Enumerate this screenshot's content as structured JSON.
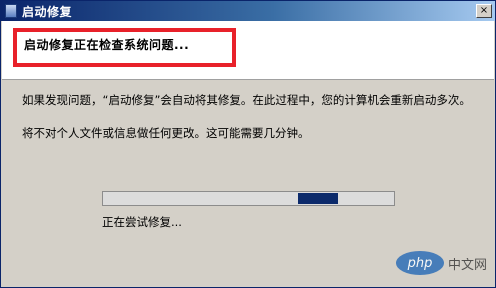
{
  "window": {
    "title": "启动修复",
    "close_label": "×"
  },
  "header": {
    "status_title": "启动修复正在检查系统问题..."
  },
  "body": {
    "paragraph1": "如果发现问题，“启动修复”会自动将其修复。在此过程中，您的计算机会重新启动多次。",
    "paragraph2": "将不对个人文件或信息做任何更改。这可能需要几分钟。"
  },
  "progress": {
    "indeterminate": true,
    "segment_position_fraction": 0.67,
    "status_text": "正在尝试修复..."
  },
  "watermark": {
    "logo_text": "php",
    "site_text": "中文网"
  },
  "colors": {
    "highlight_box": "#e8212a",
    "progress_segment": "#0c2a6b",
    "titlebar": "#0a246a"
  }
}
